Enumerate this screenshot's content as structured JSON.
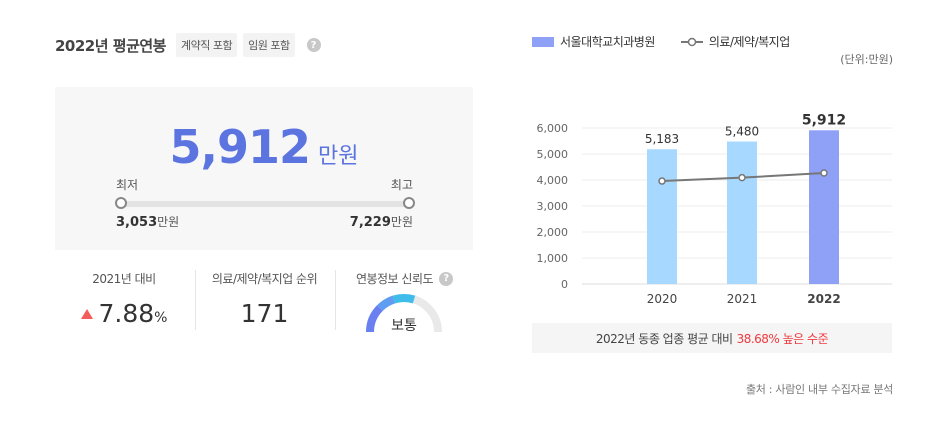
{
  "header": {
    "title": "2022년 평균연봉",
    "tags": [
      "계약직 포함",
      "임원 포함"
    ],
    "help_glyph": "?"
  },
  "salary": {
    "average": "5,912",
    "average_unit": "만원",
    "min_label": "최저",
    "max_label": "최고",
    "min_value": "3,053",
    "max_value": "7,229",
    "value_unit": "만원"
  },
  "stats": {
    "growth": {
      "label": "2021년 대비",
      "value": "7.88",
      "suffix": "%"
    },
    "rank": {
      "label": "의료/제약/복지업 순위",
      "value": "171"
    },
    "reliability": {
      "label": "연봉정보 신뢰도",
      "value": "보통",
      "level": 0.5
    }
  },
  "legend": {
    "bar_series": "서울대학교치과병원",
    "line_series": "의료/제약/복지업",
    "unit": "(단위:만원)"
  },
  "chart_data": {
    "type": "bar",
    "categories": [
      "2020",
      "2021",
      "2022"
    ],
    "series": [
      {
        "name": "서울대학교치과병원",
        "values": [
          5183,
          5480,
          5912
        ],
        "labels": [
          "5,183",
          "5,480",
          "5,912"
        ]
      },
      {
        "name": "의료/제약/복지업",
        "type": "line",
        "values": [
          3960,
          4090,
          4270
        ]
      }
    ],
    "ylim": [
      0,
      6000
    ],
    "yticks": [
      "0",
      "1,000",
      "2,000",
      "3,000",
      "4,000",
      "5,000",
      "6,000"
    ],
    "grid": true,
    "colors": {
      "bar": "#a7d8ff",
      "bar_highlight": "#8fa0f7",
      "line": "#777777"
    }
  },
  "compare": {
    "text": "2022년 동종 업종 평균 대비",
    "highlight": "38.68% 높은 수준"
  },
  "source": "출처 : 사람인 내부 수집자료 분석"
}
